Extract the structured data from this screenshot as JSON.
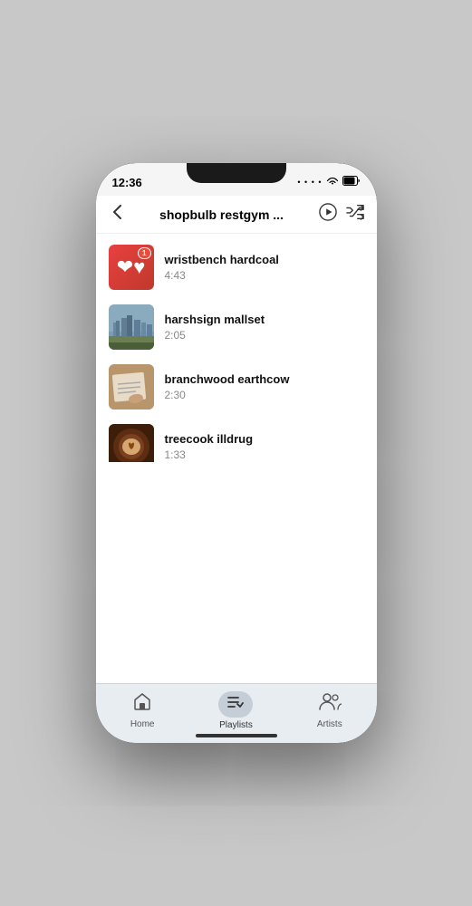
{
  "status": {
    "time": "12:36"
  },
  "header": {
    "title": "shopbulb restgym ...",
    "back_label": "‹"
  },
  "songs": [
    {
      "id": 1,
      "title": "wristbench hardcoal",
      "duration": "4:43",
      "thumb_type": "heart"
    },
    {
      "id": 2,
      "title": "harshsign mallset",
      "duration": "2:05",
      "thumb_type": "city"
    },
    {
      "id": 3,
      "title": "branchwood earthcow",
      "duration": "2:30",
      "thumb_type": "notebook"
    },
    {
      "id": 4,
      "title": "treecook illdrug",
      "duration": "1:33",
      "thumb_type": "coffee"
    }
  ],
  "tabs": [
    {
      "id": "home",
      "label": "Home",
      "active": false
    },
    {
      "id": "playlists",
      "label": "Playlists",
      "active": true
    },
    {
      "id": "artists",
      "label": "Artists",
      "active": false
    }
  ],
  "badge": {
    "count": "1"
  }
}
